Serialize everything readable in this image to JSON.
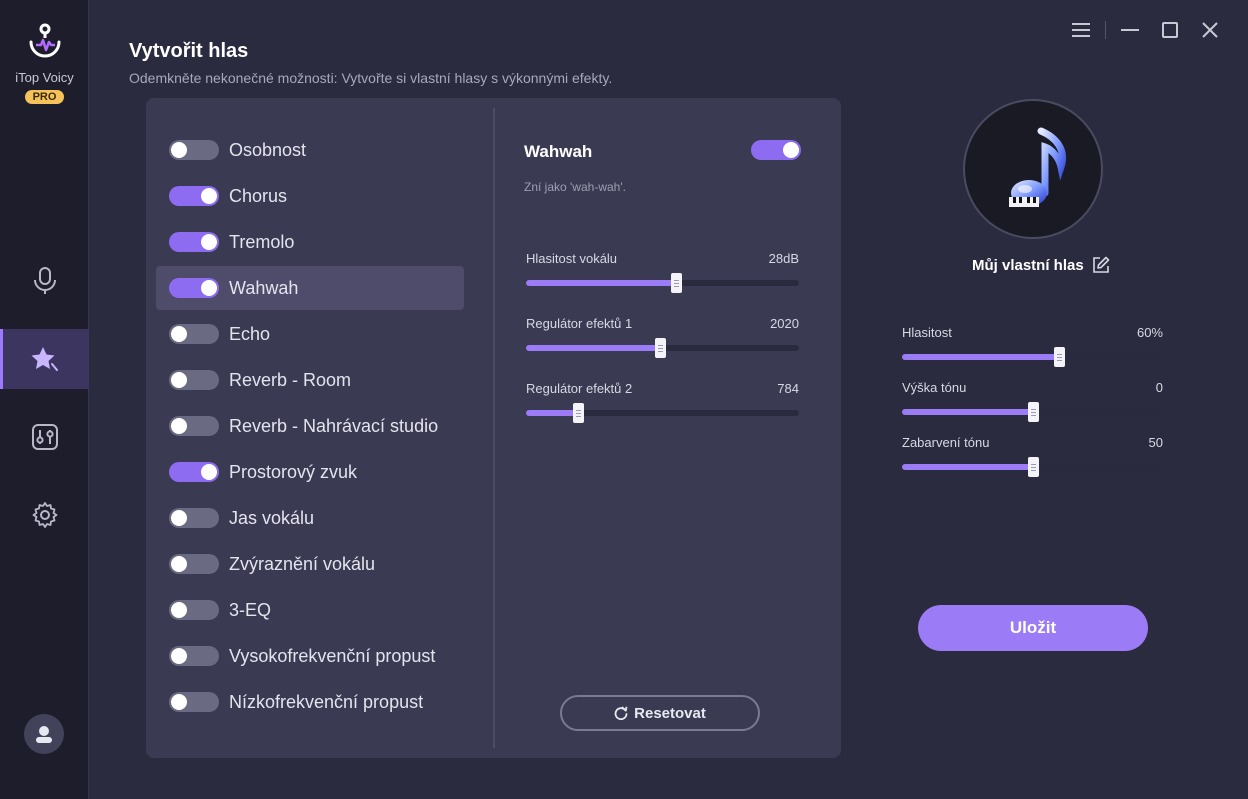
{
  "app": {
    "name": "iTop Voicy",
    "badge": "PRO",
    "accent": "#9b7cf6"
  },
  "nav": [
    {
      "icon": "microphone-icon",
      "active": false
    },
    {
      "icon": "star-magic-icon",
      "active": true
    },
    {
      "icon": "mixer-icon",
      "active": false
    },
    {
      "icon": "gear-icon",
      "active": false
    }
  ],
  "header": {
    "title": "Vytvořit hlas",
    "subtitle": "Odemkněte nekonečné možnosti: Vytvořte si vlastní hlasy s výkonnými efekty."
  },
  "effects": [
    {
      "label": "Osobnost",
      "on": false,
      "selected": false
    },
    {
      "label": "Chorus",
      "on": true,
      "selected": false
    },
    {
      "label": "Tremolo",
      "on": true,
      "selected": false
    },
    {
      "label": "Wahwah",
      "on": true,
      "selected": true
    },
    {
      "label": "Echo",
      "on": false,
      "selected": false
    },
    {
      "label": "Reverb - Room",
      "on": false,
      "selected": false
    },
    {
      "label": "Reverb - Nahrávací studio",
      "on": false,
      "selected": false
    },
    {
      "label": "Prostorový zvuk",
      "on": true,
      "selected": false
    },
    {
      "label": "Jas vokálu",
      "on": false,
      "selected": false
    },
    {
      "label": "Zvýraznění vokálu",
      "on": false,
      "selected": false
    },
    {
      "label": "3-EQ",
      "on": false,
      "selected": false
    },
    {
      "label": "Vysokofrekvenční propust",
      "on": false,
      "selected": false
    },
    {
      "label": "Nízkofrekvenční propust",
      "on": false,
      "selected": false
    }
  ],
  "detail": {
    "title": "Wahwah",
    "enabled": true,
    "description": "Zní jako 'wah-wah'.",
    "sliders": [
      {
        "label": "Hlasitost vokálu",
        "value": "28dB",
        "fraction": 0.55
      },
      {
        "label": "Regulátor efektů 1",
        "value": "2020",
        "fraction": 0.49
      },
      {
        "label": "Regulátor efektů 2",
        "value": "784",
        "fraction": 0.19
      }
    ],
    "reset_label": "Resetovat"
  },
  "voice": {
    "name": "Můj vlastní hlas",
    "sliders": [
      {
        "label": "Hlasitost",
        "value": "60%",
        "fraction": 0.6
      },
      {
        "label": "Výška tónu",
        "value": "0",
        "fraction": 0.5
      },
      {
        "label": "Zabarvení tónu",
        "value": "50",
        "fraction": 0.5
      }
    ],
    "save_label": "Uložit"
  }
}
